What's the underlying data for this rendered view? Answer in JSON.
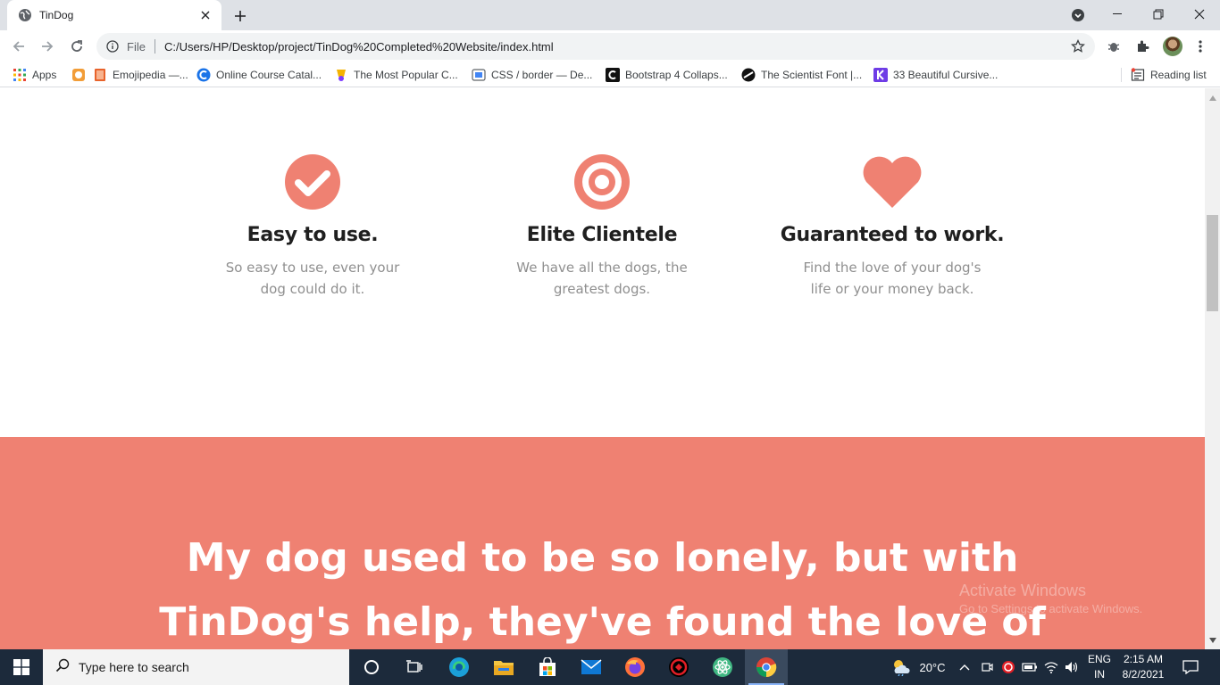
{
  "browser": {
    "tab_title": "TinDog",
    "url_scheme": "File",
    "url": "C:/Users/HP/Desktop/project/TinDog%20Completed%20Website/index.html"
  },
  "bookmarks": [
    {
      "label": "Apps",
      "icon": "apps-grid-icon"
    },
    {
      "label": "Emojipedia —...",
      "icon": "emojipedia-icon"
    },
    {
      "label": "Online Course Catal...",
      "icon": "course-catalog-icon"
    },
    {
      "label": "The Most Popular C...",
      "icon": "popular-icon"
    },
    {
      "label": "CSS / border — De...",
      "icon": "css-icon"
    },
    {
      "label": "Bootstrap 4 Collaps...",
      "icon": "bootstrap-icon"
    },
    {
      "label": "The Scientist Font |...",
      "icon": "font-icon"
    },
    {
      "label": "33 Beautiful Cursive...",
      "icon": "cursive-icon"
    }
  ],
  "reading_list": "Reading list",
  "features": [
    {
      "icon": "check-circle-icon",
      "title": "Easy to use.",
      "text": "So easy to use, even your dog could do it."
    },
    {
      "icon": "bullseye-icon",
      "title": "Elite Clientele",
      "text": "We have all the dogs, the greatest dogs."
    },
    {
      "icon": "heart-icon",
      "title": "Guaranteed to work.",
      "text": "Find the love of your dog's life or your money back."
    }
  ],
  "testimonial": {
    "quote": "My dog used to be so lonely, but with TinDog's help, they've found the love of"
  },
  "watermark": {
    "line1": "Activate Windows",
    "line2": "Go to Settings to activate Windows."
  },
  "taskbar": {
    "search_placeholder": "Type here to search",
    "temperature": "20°C",
    "lang_line1": "ENG",
    "lang_line2": "IN",
    "time": "2:15 AM",
    "date": "8/2/2021"
  },
  "colors": {
    "accent": "#ef8172",
    "heading": "#1f1f1f",
    "muted_text": "#8f8f8f"
  }
}
